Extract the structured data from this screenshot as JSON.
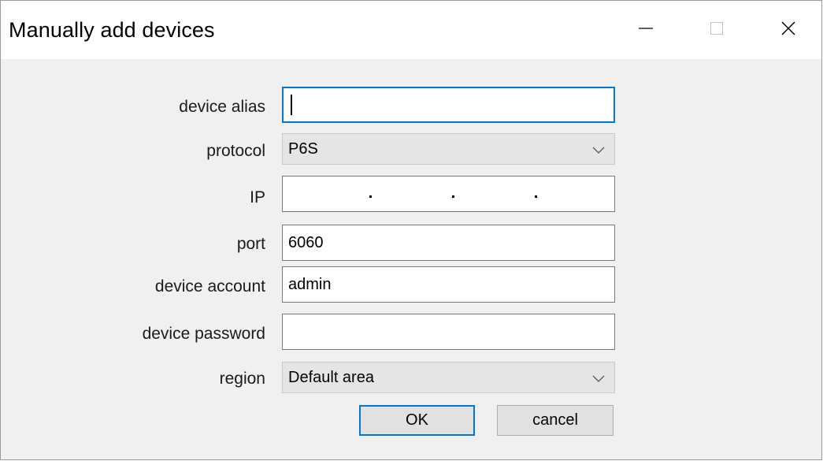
{
  "window": {
    "title": "Manually add devices",
    "controls": {
      "minimize_icon": "minimize-icon",
      "maximize_icon": "maximize-icon",
      "close_icon": "close-icon"
    }
  },
  "form": {
    "alias": {
      "label": "device alias",
      "value": ""
    },
    "protocol": {
      "label": "protocol",
      "value": "P6S"
    },
    "ip": {
      "label": "IP",
      "value": ""
    },
    "port": {
      "label": "port",
      "value": "6060"
    },
    "account": {
      "label": "device account",
      "value": "admin"
    },
    "password": {
      "label": "device password",
      "value": ""
    },
    "region": {
      "label": "region",
      "value": "Default area"
    }
  },
  "buttons": {
    "ok": "OK",
    "cancel": "cancel"
  },
  "colors": {
    "accent": "#0078d7",
    "dialog_bg": "#f0f0f0",
    "titlebar_bg": "#ffffff"
  }
}
